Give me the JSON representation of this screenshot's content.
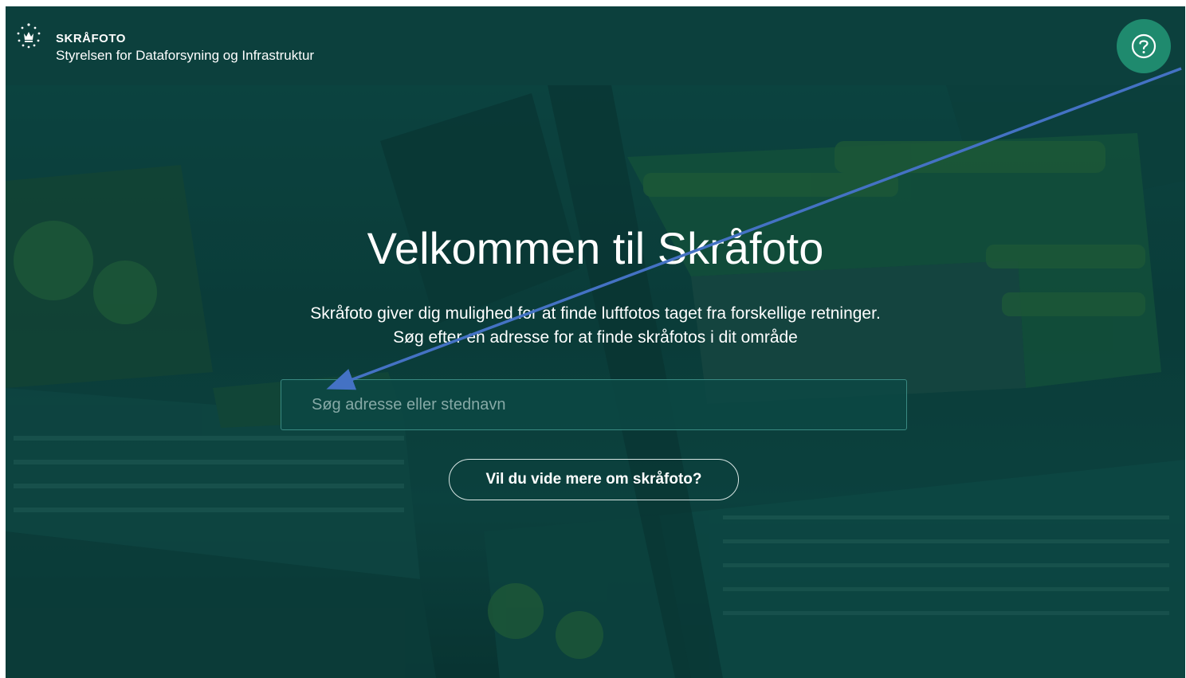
{
  "header": {
    "app_name": "SKRÅFOTO",
    "org_name": "Styrelsen for Dataforsyning og Infrastruktur",
    "help_icon": "help-circle-icon",
    "help_color": "#1f8a6e",
    "background_color": "#0c403d"
  },
  "hero": {
    "title": "Velkommen til Skråfoto",
    "subtitle_line1": "Skråfoto giver dig mulighed for at finde luftfotos taget fra forskellige retninger.",
    "subtitle_line2": "Søg efter en adresse for at finde skråfotos i dit område",
    "search": {
      "placeholder": "Søg adresse eller stednavn",
      "value": ""
    },
    "more_button_label": "Vil du vide mere om skråfoto?"
  },
  "annotation": {
    "type": "arrow",
    "color": "#4472c4"
  }
}
